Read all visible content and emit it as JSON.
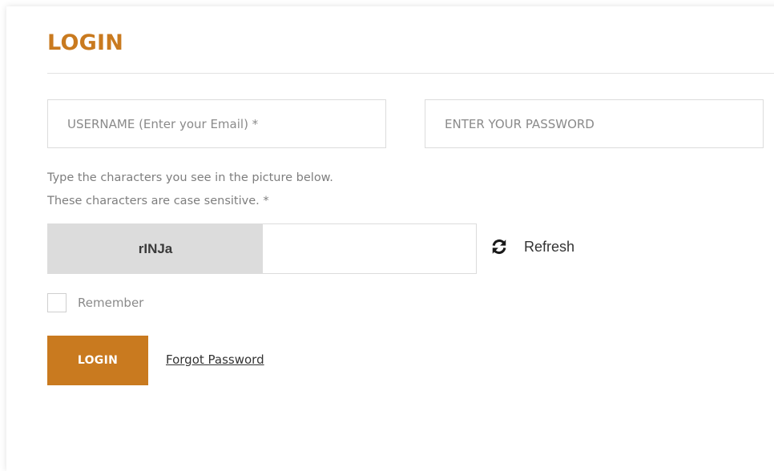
{
  "form": {
    "title": "LOGIN",
    "username_placeholder": "USERNAME (Enter your Email) *",
    "password_placeholder": "ENTER YOUR PASSWORD",
    "captcha_hint_line1": "Type the characters you see in the picture below.",
    "captcha_hint_line2": "These characters are case sensitive. *",
    "captcha_text": "rINJa",
    "refresh_label": "Refresh",
    "remember_label": "Remember",
    "login_button": "LOGIN",
    "forgot_password": "Forgot Password"
  },
  "icons": {
    "refresh": "refresh-icon"
  },
  "colors": {
    "accent": "#c97a1f",
    "captcha_bg": "#dcdcdc"
  }
}
